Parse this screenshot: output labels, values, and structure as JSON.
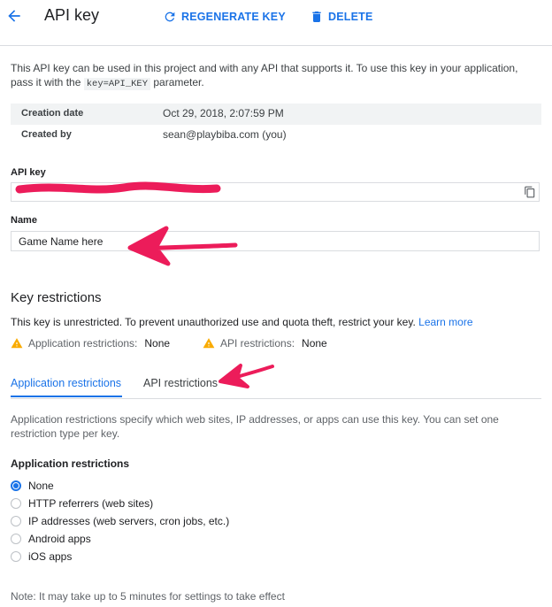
{
  "header": {
    "title": "API key",
    "regenerate_label": "REGENERATE KEY",
    "delete_label": "DELETE"
  },
  "intro": {
    "text_before": "This API key can be used in this project and with any API that supports it. To use this key in your application, pass it with the ",
    "code": "key=API_KEY",
    "text_after": " parameter."
  },
  "meta": {
    "created_label": "Creation date",
    "created_value": "Oct 29, 2018, 2:07:59 PM",
    "by_label": "Created by",
    "by_value": "sean@playbiba.com (you)"
  },
  "api_key": {
    "label": "API key",
    "value": ""
  },
  "name_field": {
    "label": "Name",
    "value": "Game Name here"
  },
  "restrictions": {
    "heading": "Key restrictions",
    "warning": "This key is unrestricted. To prevent unauthorized use and quota theft, restrict your key.",
    "learn_more": "Learn more",
    "app_label": "Application restrictions:",
    "app_value": "None",
    "api_label": "API restrictions:",
    "api_value": "None"
  },
  "tabs": [
    {
      "label": "Application restrictions"
    },
    {
      "label": "API restrictions"
    }
  ],
  "app_restrictions": {
    "description": "Application restrictions specify which web sites, IP addresses, or apps can use this key. You can set one restriction type per key.",
    "heading": "Application restrictions",
    "options": [
      {
        "label": "None"
      },
      {
        "label": "HTTP referrers (web sites)"
      },
      {
        "label": "IP addresses (web servers, cron jobs, etc.)"
      },
      {
        "label": "Android apps"
      },
      {
        "label": "iOS apps"
      }
    ],
    "selected": "None"
  },
  "note": "Note: It may take up to 5 minutes for settings to take effect",
  "colors": {
    "accent": "#1a73e8",
    "warning": "#f9ab00",
    "annotation": "#ec1c5a"
  }
}
